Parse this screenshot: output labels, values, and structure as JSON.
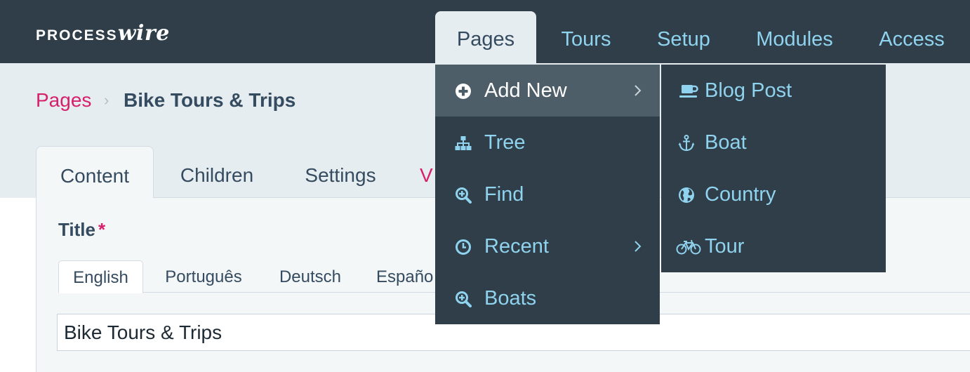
{
  "masthead": {
    "logo_process": "PROCESS",
    "logo_wire": "wire",
    "nav": [
      "Pages",
      "Tours",
      "Setup",
      "Modules",
      "Access"
    ]
  },
  "breadcrumb": {
    "link": "Pages",
    "separator": "›",
    "current": "Bike Tours & Trips"
  },
  "tabs": [
    "Content",
    "Children",
    "Settings",
    "V"
  ],
  "field": {
    "label": "Title",
    "required_marker": "*",
    "languages": [
      "English",
      "Português",
      "Deutsch",
      "Españo"
    ],
    "value": "Bike Tours & Trips"
  },
  "pages_menu": {
    "items": [
      {
        "label": "Add New",
        "icon": "plus-circle-icon",
        "has_submenu": true,
        "hover": true
      },
      {
        "label": "Tree",
        "icon": "sitemap-icon",
        "has_submenu": false
      },
      {
        "label": "Find",
        "icon": "search-plus-icon",
        "has_submenu": false
      },
      {
        "label": "Recent",
        "icon": "clock-icon",
        "has_submenu": true
      },
      {
        "label": "Boats",
        "icon": "search-plus-icon",
        "has_submenu": false
      }
    ]
  },
  "add_new_menu": {
    "items": [
      {
        "label": "Blog Post",
        "icon": "coffee-icon"
      },
      {
        "label": "Boat",
        "icon": "anchor-icon"
      },
      {
        "label": "Country",
        "icon": "globe-icon"
      },
      {
        "label": "Tour",
        "icon": "bicycle-icon"
      }
    ]
  },
  "colors": {
    "masthead": "#2f3e48",
    "accent_link": "#d6206b",
    "menu_text": "#8fd3ef",
    "menu_hover": "#4d5e68",
    "body_bg": "#e6edf0"
  }
}
